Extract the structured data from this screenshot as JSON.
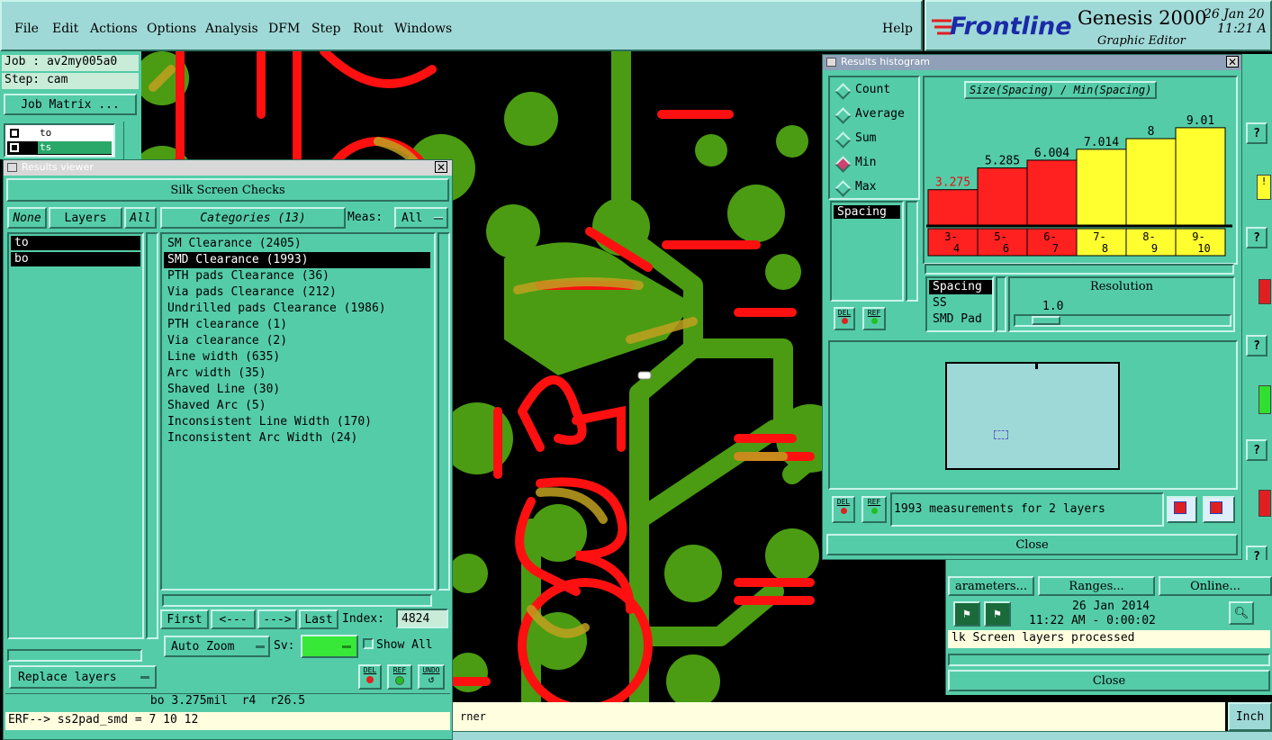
{
  "menu": {
    "items": [
      "File",
      "Edit",
      "Actions",
      "Options",
      "Analysis",
      "DFM",
      "Step",
      "Rout",
      "Windows"
    ],
    "help": "Help"
  },
  "brand": {
    "logo": "Frontline",
    "product": "Genesis 2000",
    "subtitle": "Graphic Editor",
    "date": "26 Jan 20",
    "time": "11:21 A"
  },
  "job_panel": {
    "job": "Job : av2my005a0",
    "step": "Step: cam",
    "matrix_button": "Job Matrix ...",
    "layers": [
      {
        "name": "to",
        "selected": true
      },
      {
        "name": "ts",
        "selected": false
      }
    ]
  },
  "results_viewer": {
    "title": "Results viewer",
    "header": "Silk Screen Checks",
    "none_label": "None",
    "layers_label": "Layers",
    "all_label": "All",
    "categories_label": "Categories (13)",
    "meas_label": "Meas:",
    "meas_value": "All",
    "layers": [
      "to",
      "bo"
    ],
    "categories": [
      "SM Clearance (2405)",
      "SMD Clearance (1993)",
      "PTH pads Clearance (36)",
      "Via pads Clearance (212)",
      "Undrilled pads Clearance (1986)",
      "PTH clearance (1)",
      "Via clearance (2)",
      "Line width (635)",
      "Arc width (35)",
      "Shaved Line (30)",
      "Shaved Arc (5)",
      "Inconsistent Line Width (170)",
      "Inconsistent Arc Width (24)"
    ],
    "selected_category_index": 1,
    "nav": {
      "first": "First",
      "prev": "<---",
      "next": "--->",
      "last": "Last",
      "index_label": "Index:",
      "index_value": "4824"
    },
    "auto_zoom": "Auto Zoom",
    "sv_label": "Sv:",
    "show_all": "Show All",
    "replace_layers": "Replace layers",
    "del": "DEL",
    "ref": "REF",
    "undo": "UNDO",
    "status": "bo 3.275mil  r4  r26.5",
    "erf_line": "ERF--> ss2pad_smd = 7 10 12"
  },
  "histogram": {
    "title": "Results histogram",
    "stat_options": [
      {
        "label": "Count",
        "checked": false
      },
      {
        "label": "Average",
        "checked": false
      },
      {
        "label": "Sum",
        "checked": false
      },
      {
        "label": "Min",
        "checked": true
      },
      {
        "label": "Max",
        "checked": false
      }
    ],
    "measure_list": [
      "Spacing"
    ],
    "chart_title": "Size(Spacing) / Min(Spacing)",
    "resolution_label": "Resolution",
    "resolution_value": "1.0",
    "type_list": [
      "Spacing",
      "SS",
      "SMD Pad"
    ],
    "summary": "1993 measurements for 2 layers",
    "close": "Close",
    "del": "DEL",
    "ref": "REF"
  },
  "chart_data": {
    "type": "bar",
    "title": "Size(Spacing) / Min(Spacing)",
    "categories": [
      "3-\n4",
      "5-\n6",
      "6-\n7",
      "7-\n8",
      "8-\n9",
      "9-\n10"
    ],
    "values": [
      3.275,
      5.285,
      6.004,
      7.014,
      8,
      9.01
    ],
    "value_labels": [
      "3.275",
      "5.285",
      "6.004",
      "7.014",
      "8",
      "9.01"
    ],
    "colors": [
      "#ff2020",
      "#ff2020",
      "#ff2020",
      "#ffff30",
      "#ffff30",
      "#ffff30"
    ],
    "ylim": [
      0,
      10
    ],
    "grid": false
  },
  "right_panel": {
    "check_label": "Silk Screen Checks",
    "erf_label": "ERF",
    "parameters": "arameters...",
    "ranges": "Ranges...",
    "online": "Online...",
    "date": "26 Jan 2014",
    "time": "11:22 AM - 0:00:02",
    "status": "lk Screen layers processed",
    "close": "Close"
  },
  "bottom": {
    "message": "rner",
    "units": "Inch"
  },
  "colors": {
    "panel": "#55cca8",
    "menubar": "#9fd9d7",
    "copper": "#4b9c12",
    "silk": "#ff1010",
    "overlap": "#c0a020"
  }
}
